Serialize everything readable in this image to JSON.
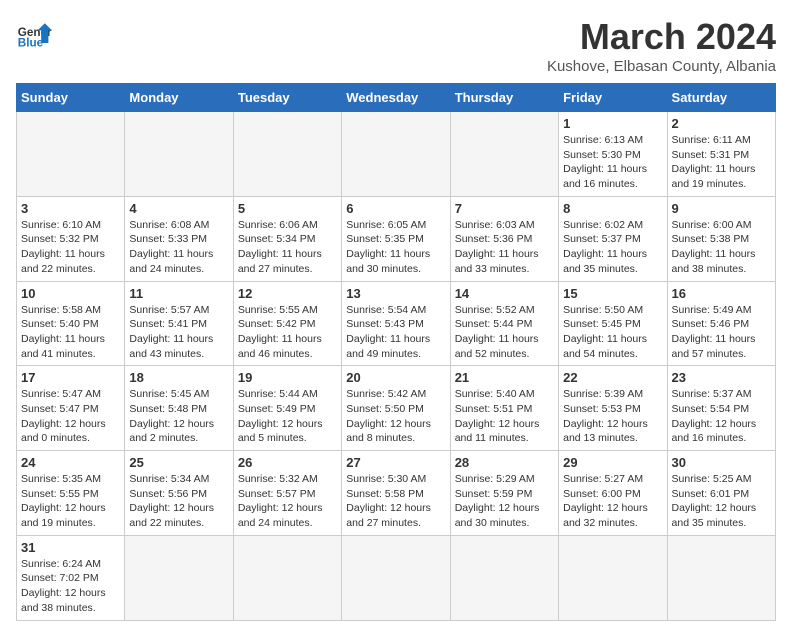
{
  "header": {
    "logo_general": "General",
    "logo_blue": "Blue",
    "month_title": "March 2024",
    "subtitle": "Kushove, Elbasan County, Albania"
  },
  "columns": [
    "Sunday",
    "Monday",
    "Tuesday",
    "Wednesday",
    "Thursday",
    "Friday",
    "Saturday"
  ],
  "weeks": [
    [
      {
        "day": "",
        "info": ""
      },
      {
        "day": "",
        "info": ""
      },
      {
        "day": "",
        "info": ""
      },
      {
        "day": "",
        "info": ""
      },
      {
        "day": "",
        "info": ""
      },
      {
        "day": "1",
        "info": "Sunrise: 6:13 AM\nSunset: 5:30 PM\nDaylight: 11 hours and 16 minutes."
      },
      {
        "day": "2",
        "info": "Sunrise: 6:11 AM\nSunset: 5:31 PM\nDaylight: 11 hours and 19 minutes."
      }
    ],
    [
      {
        "day": "3",
        "info": "Sunrise: 6:10 AM\nSunset: 5:32 PM\nDaylight: 11 hours and 22 minutes."
      },
      {
        "day": "4",
        "info": "Sunrise: 6:08 AM\nSunset: 5:33 PM\nDaylight: 11 hours and 24 minutes."
      },
      {
        "day": "5",
        "info": "Sunrise: 6:06 AM\nSunset: 5:34 PM\nDaylight: 11 hours and 27 minutes."
      },
      {
        "day": "6",
        "info": "Sunrise: 6:05 AM\nSunset: 5:35 PM\nDaylight: 11 hours and 30 minutes."
      },
      {
        "day": "7",
        "info": "Sunrise: 6:03 AM\nSunset: 5:36 PM\nDaylight: 11 hours and 33 minutes."
      },
      {
        "day": "8",
        "info": "Sunrise: 6:02 AM\nSunset: 5:37 PM\nDaylight: 11 hours and 35 minutes."
      },
      {
        "day": "9",
        "info": "Sunrise: 6:00 AM\nSunset: 5:38 PM\nDaylight: 11 hours and 38 minutes."
      }
    ],
    [
      {
        "day": "10",
        "info": "Sunrise: 5:58 AM\nSunset: 5:40 PM\nDaylight: 11 hours and 41 minutes."
      },
      {
        "day": "11",
        "info": "Sunrise: 5:57 AM\nSunset: 5:41 PM\nDaylight: 11 hours and 43 minutes."
      },
      {
        "day": "12",
        "info": "Sunrise: 5:55 AM\nSunset: 5:42 PM\nDaylight: 11 hours and 46 minutes."
      },
      {
        "day": "13",
        "info": "Sunrise: 5:54 AM\nSunset: 5:43 PM\nDaylight: 11 hours and 49 minutes."
      },
      {
        "day": "14",
        "info": "Sunrise: 5:52 AM\nSunset: 5:44 PM\nDaylight: 11 hours and 52 minutes."
      },
      {
        "day": "15",
        "info": "Sunrise: 5:50 AM\nSunset: 5:45 PM\nDaylight: 11 hours and 54 minutes."
      },
      {
        "day": "16",
        "info": "Sunrise: 5:49 AM\nSunset: 5:46 PM\nDaylight: 11 hours and 57 minutes."
      }
    ],
    [
      {
        "day": "17",
        "info": "Sunrise: 5:47 AM\nSunset: 5:47 PM\nDaylight: 12 hours and 0 minutes."
      },
      {
        "day": "18",
        "info": "Sunrise: 5:45 AM\nSunset: 5:48 PM\nDaylight: 12 hours and 2 minutes."
      },
      {
        "day": "19",
        "info": "Sunrise: 5:44 AM\nSunset: 5:49 PM\nDaylight: 12 hours and 5 minutes."
      },
      {
        "day": "20",
        "info": "Sunrise: 5:42 AM\nSunset: 5:50 PM\nDaylight: 12 hours and 8 minutes."
      },
      {
        "day": "21",
        "info": "Sunrise: 5:40 AM\nSunset: 5:51 PM\nDaylight: 12 hours and 11 minutes."
      },
      {
        "day": "22",
        "info": "Sunrise: 5:39 AM\nSunset: 5:53 PM\nDaylight: 12 hours and 13 minutes."
      },
      {
        "day": "23",
        "info": "Sunrise: 5:37 AM\nSunset: 5:54 PM\nDaylight: 12 hours and 16 minutes."
      }
    ],
    [
      {
        "day": "24",
        "info": "Sunrise: 5:35 AM\nSunset: 5:55 PM\nDaylight: 12 hours and 19 minutes."
      },
      {
        "day": "25",
        "info": "Sunrise: 5:34 AM\nSunset: 5:56 PM\nDaylight: 12 hours and 22 minutes."
      },
      {
        "day": "26",
        "info": "Sunrise: 5:32 AM\nSunset: 5:57 PM\nDaylight: 12 hours and 24 minutes."
      },
      {
        "day": "27",
        "info": "Sunrise: 5:30 AM\nSunset: 5:58 PM\nDaylight: 12 hours and 27 minutes."
      },
      {
        "day": "28",
        "info": "Sunrise: 5:29 AM\nSunset: 5:59 PM\nDaylight: 12 hours and 30 minutes."
      },
      {
        "day": "29",
        "info": "Sunrise: 5:27 AM\nSunset: 6:00 PM\nDaylight: 12 hours and 32 minutes."
      },
      {
        "day": "30",
        "info": "Sunrise: 5:25 AM\nSunset: 6:01 PM\nDaylight: 12 hours and 35 minutes."
      }
    ],
    [
      {
        "day": "31",
        "info": "Sunrise: 6:24 AM\nSunset: 7:02 PM\nDaylight: 12 hours and 38 minutes."
      },
      {
        "day": "",
        "info": ""
      },
      {
        "day": "",
        "info": ""
      },
      {
        "day": "",
        "info": ""
      },
      {
        "day": "",
        "info": ""
      },
      {
        "day": "",
        "info": ""
      },
      {
        "day": "",
        "info": ""
      }
    ]
  ]
}
